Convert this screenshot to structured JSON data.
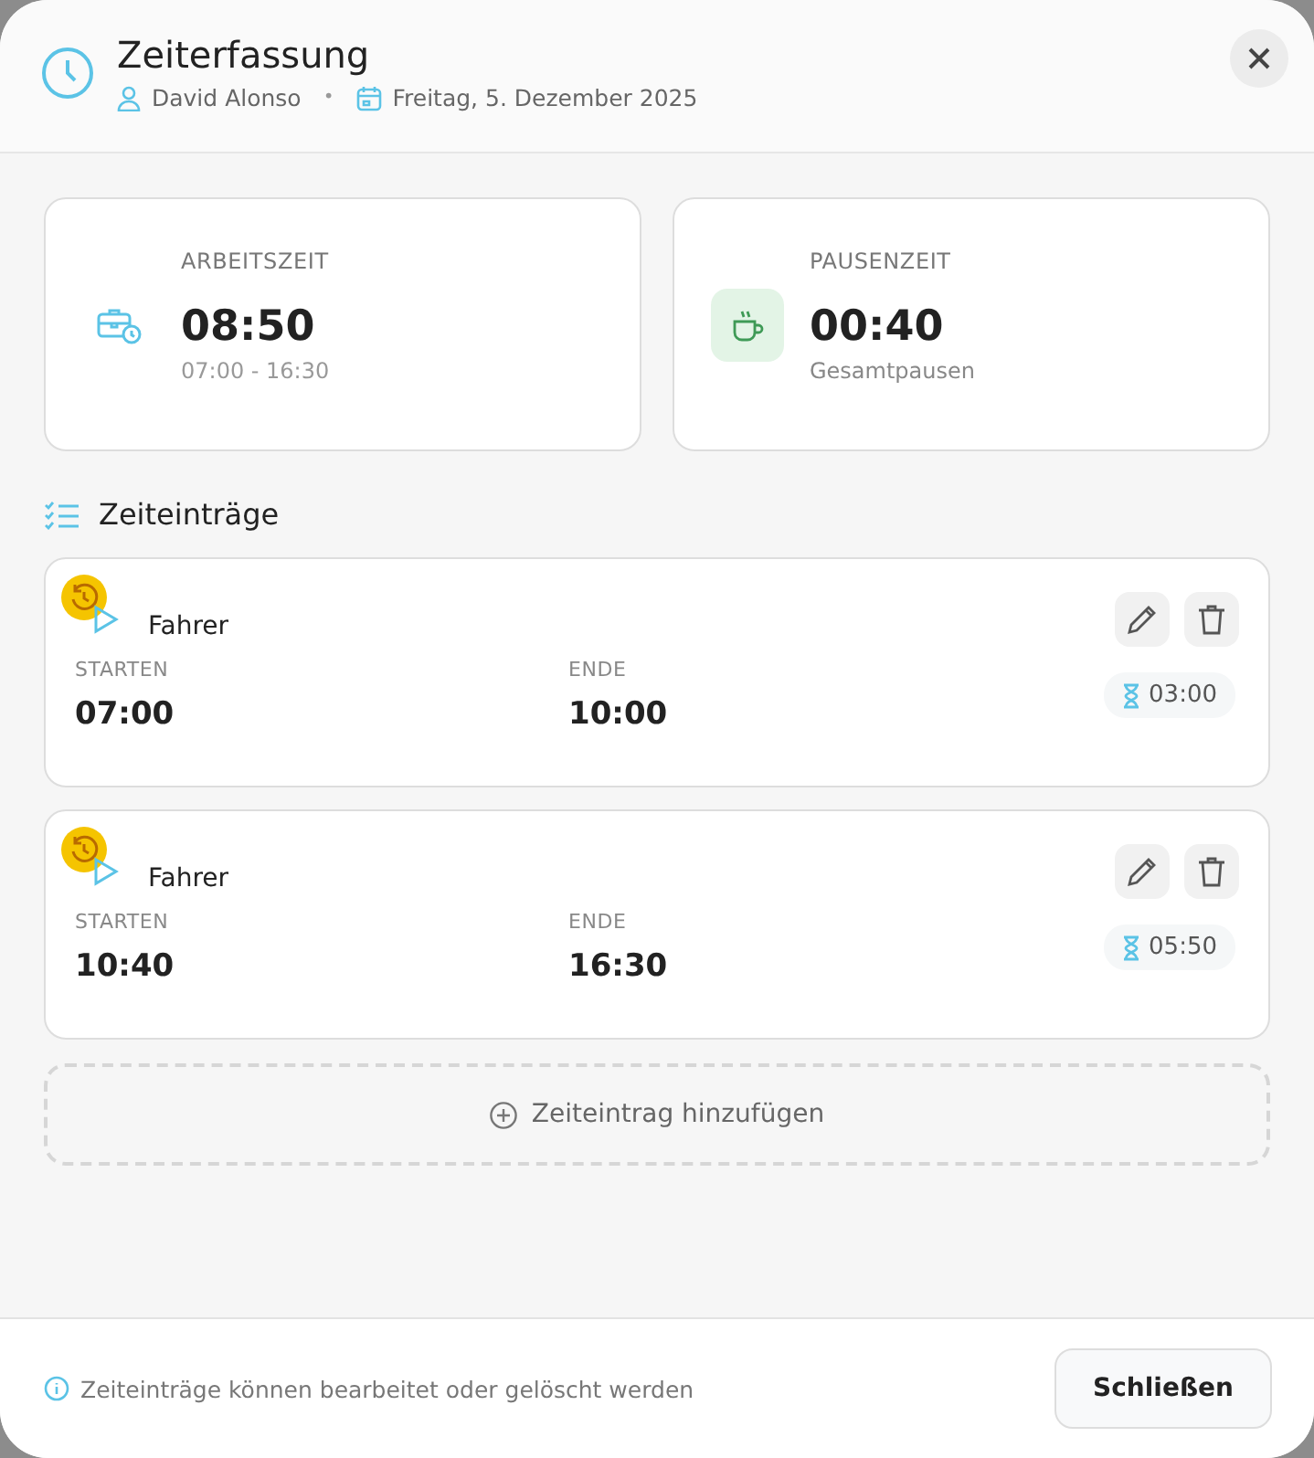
{
  "header": {
    "title": "Zeiterfassung",
    "user": "David Alonso",
    "separator": "•",
    "date": "Freitag, 5. Dezember 2025"
  },
  "summary": [
    {
      "kind": "work",
      "label": "ARBEITSZEIT",
      "value": "08:50",
      "sub": "07:00 - 16:30"
    },
    {
      "kind": "break",
      "label": "PAUSENZEIT",
      "value": "00:40",
      "sub": "Gesamtpausen"
    }
  ],
  "entries_title": "Zeiteinträge",
  "entries": [
    {
      "role": "Fahrer",
      "start_label": "STARTEN",
      "start": "07:00",
      "end_label": "ENDE",
      "end": "10:00",
      "duration": "03:00"
    },
    {
      "role": "Fahrer",
      "start_label": "STARTEN",
      "start": "10:40",
      "end_label": "ENDE",
      "end": "16:30",
      "duration": "05:50"
    }
  ],
  "add_button": "Zeiteintrag hinzufügen",
  "footer": {
    "hint": "Zeiteinträge können bearbeitet oder gelöscht werden",
    "close_button": "Schließen"
  }
}
